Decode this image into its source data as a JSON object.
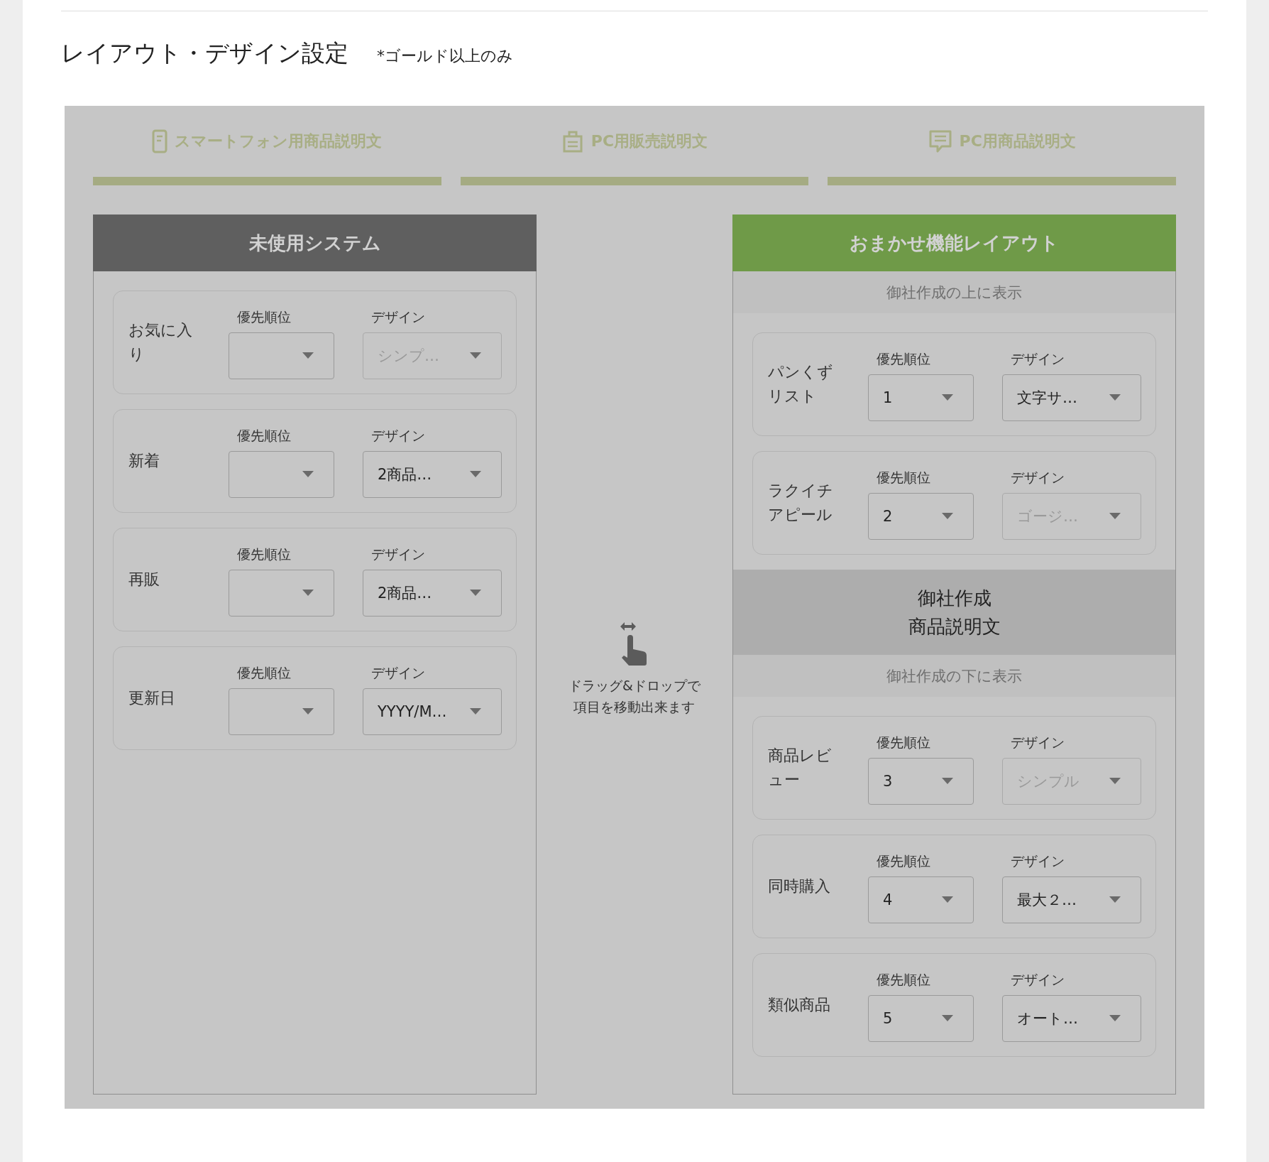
{
  "title": "レイアウト・デザイン設定",
  "note": "*ゴールド以上のみ",
  "tabs": [
    {
      "label": "スマートフォン用商品説明文"
    },
    {
      "label": "PC用販売説明文"
    },
    {
      "label": "PC用商品説明文"
    }
  ],
  "unused": {
    "header": "未使用システム",
    "items": [
      {
        "label": "お気に入り",
        "priority_label": "優先順位",
        "design_label": "デザイン",
        "design": "シンプ…",
        "design_disabled": true
      },
      {
        "label": "新着",
        "priority_label": "優先順位",
        "design_label": "デザイン",
        "design": "2商品…",
        "design_disabled": false
      },
      {
        "label": "再販",
        "priority_label": "優先順位",
        "design_label": "デザイン",
        "design": "2商品…",
        "design_disabled": false
      },
      {
        "label": "更新日",
        "priority_label": "優先順位",
        "design_label": "デザイン",
        "design": "YYYY/M…",
        "design_disabled": false
      }
    ]
  },
  "hint": [
    "ドラッグ&ドロップで",
    "項目を移動出来ます"
  ],
  "auto": {
    "header": "おまかせ機能レイアウト",
    "above_caption": "御社作成の上に表示",
    "above_items": [
      {
        "label": "パンくずリスト",
        "priority_label": "優先順位",
        "priority": "1",
        "design_label": "デザイン",
        "design": "文字サ…",
        "design_disabled": false
      },
      {
        "label": "ラクイチアピール",
        "priority_label": "優先順位",
        "priority": "2",
        "design_label": "デザイン",
        "design": "ゴージ…",
        "design_disabled": true
      }
    ],
    "own_block": [
      "御社作成",
      "商品説明文"
    ],
    "below_caption": "御社作成の下に表示",
    "below_items": [
      {
        "label": "商品レビュー",
        "priority_label": "優先順位",
        "priority": "3",
        "design_label": "デザイン",
        "design": "シンプル",
        "design_disabled": true
      },
      {
        "label": "同時購入",
        "priority_label": "優先順位",
        "priority": "4",
        "design_label": "デザイン",
        "design": "最大２…",
        "design_disabled": false
      },
      {
        "label": "類似商品",
        "priority_label": "優先順位",
        "priority": "5",
        "design_label": "デザイン",
        "design": "オート…",
        "design_disabled": false
      }
    ]
  }
}
